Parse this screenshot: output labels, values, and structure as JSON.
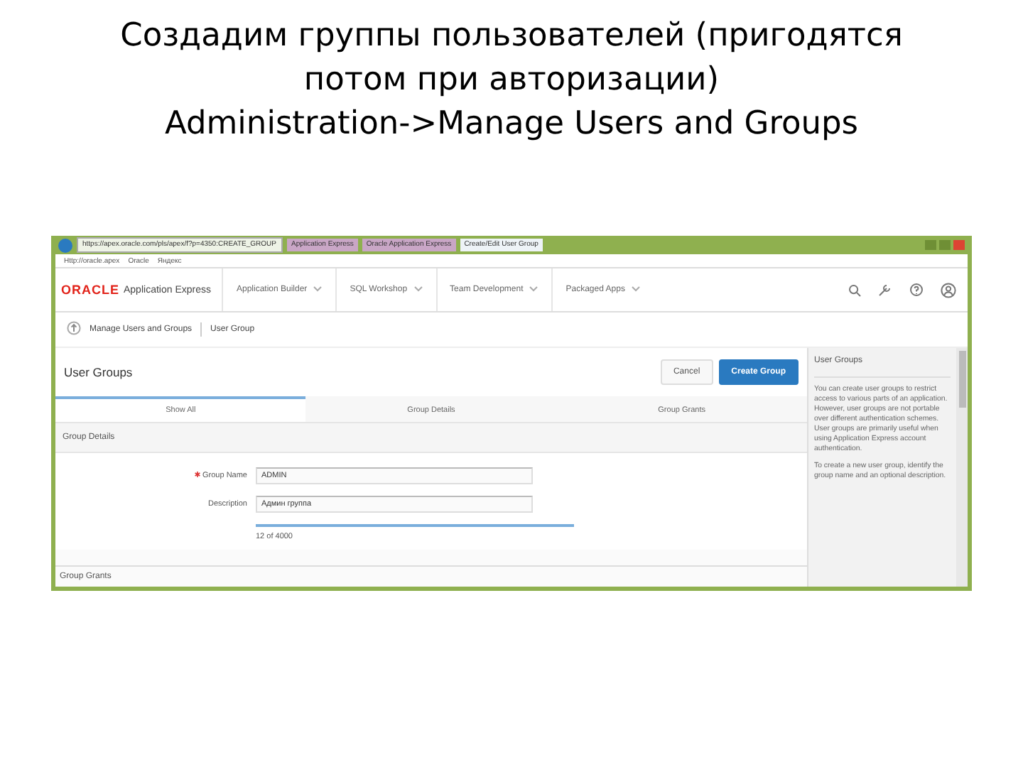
{
  "slide": {
    "title_lines": [
      "Создадим группы пользователей (пригодятся",
      "потом при авторизации)",
      "Administration->Manage Users and Groups"
    ]
  },
  "browser": {
    "address": "https://apex.oracle.com/pls/apex/f?p=4350:CREATE_GROUP",
    "tabs": [
      {
        "label": "Application Express",
        "selected": false
      },
      {
        "label": "Oracle Application Express",
        "selected": false
      },
      {
        "label": "Create/Edit User Group",
        "selected": true
      }
    ],
    "bookmarks": [
      "Http://oracle.apex",
      "Oracle",
      "Яндекс"
    ]
  },
  "header": {
    "logo": "ORACLE",
    "product": "Application Express",
    "menus": [
      "Application Builder",
      "SQL Workshop",
      "Team Development",
      "Packaged Apps"
    ]
  },
  "breadcrumb": [
    "Manage Users and Groups",
    "User Group"
  ],
  "region": {
    "title": "User Groups",
    "buttons": [
      {
        "label": "Cancel",
        "kind": "plain"
      },
      {
        "label": "Create Group",
        "kind": "hot"
      }
    ]
  },
  "page_tabs": [
    {
      "label": "Show All",
      "selected": true
    },
    {
      "label": "Group Details",
      "selected": false
    },
    {
      "label": "Group Grants",
      "selected": false
    }
  ],
  "group_details": {
    "heading": "Group Details",
    "fields": [
      {
        "label": "Group Name",
        "value": "ADMIN",
        "required": true
      },
      {
        "label": "Description",
        "value": "Админ группа"
      }
    ],
    "counter": "12 of 4000"
  },
  "next_section": "Group Grants",
  "help": {
    "title": "User Groups",
    "paragraphs": [
      "You can create user groups to restrict access to various parts of an application. However, user groups are not portable over different authentication schemes. User groups are primarily useful when using Application Express account authentication.",
      "To create a new user group, identify the group name and an optional description."
    ]
  }
}
